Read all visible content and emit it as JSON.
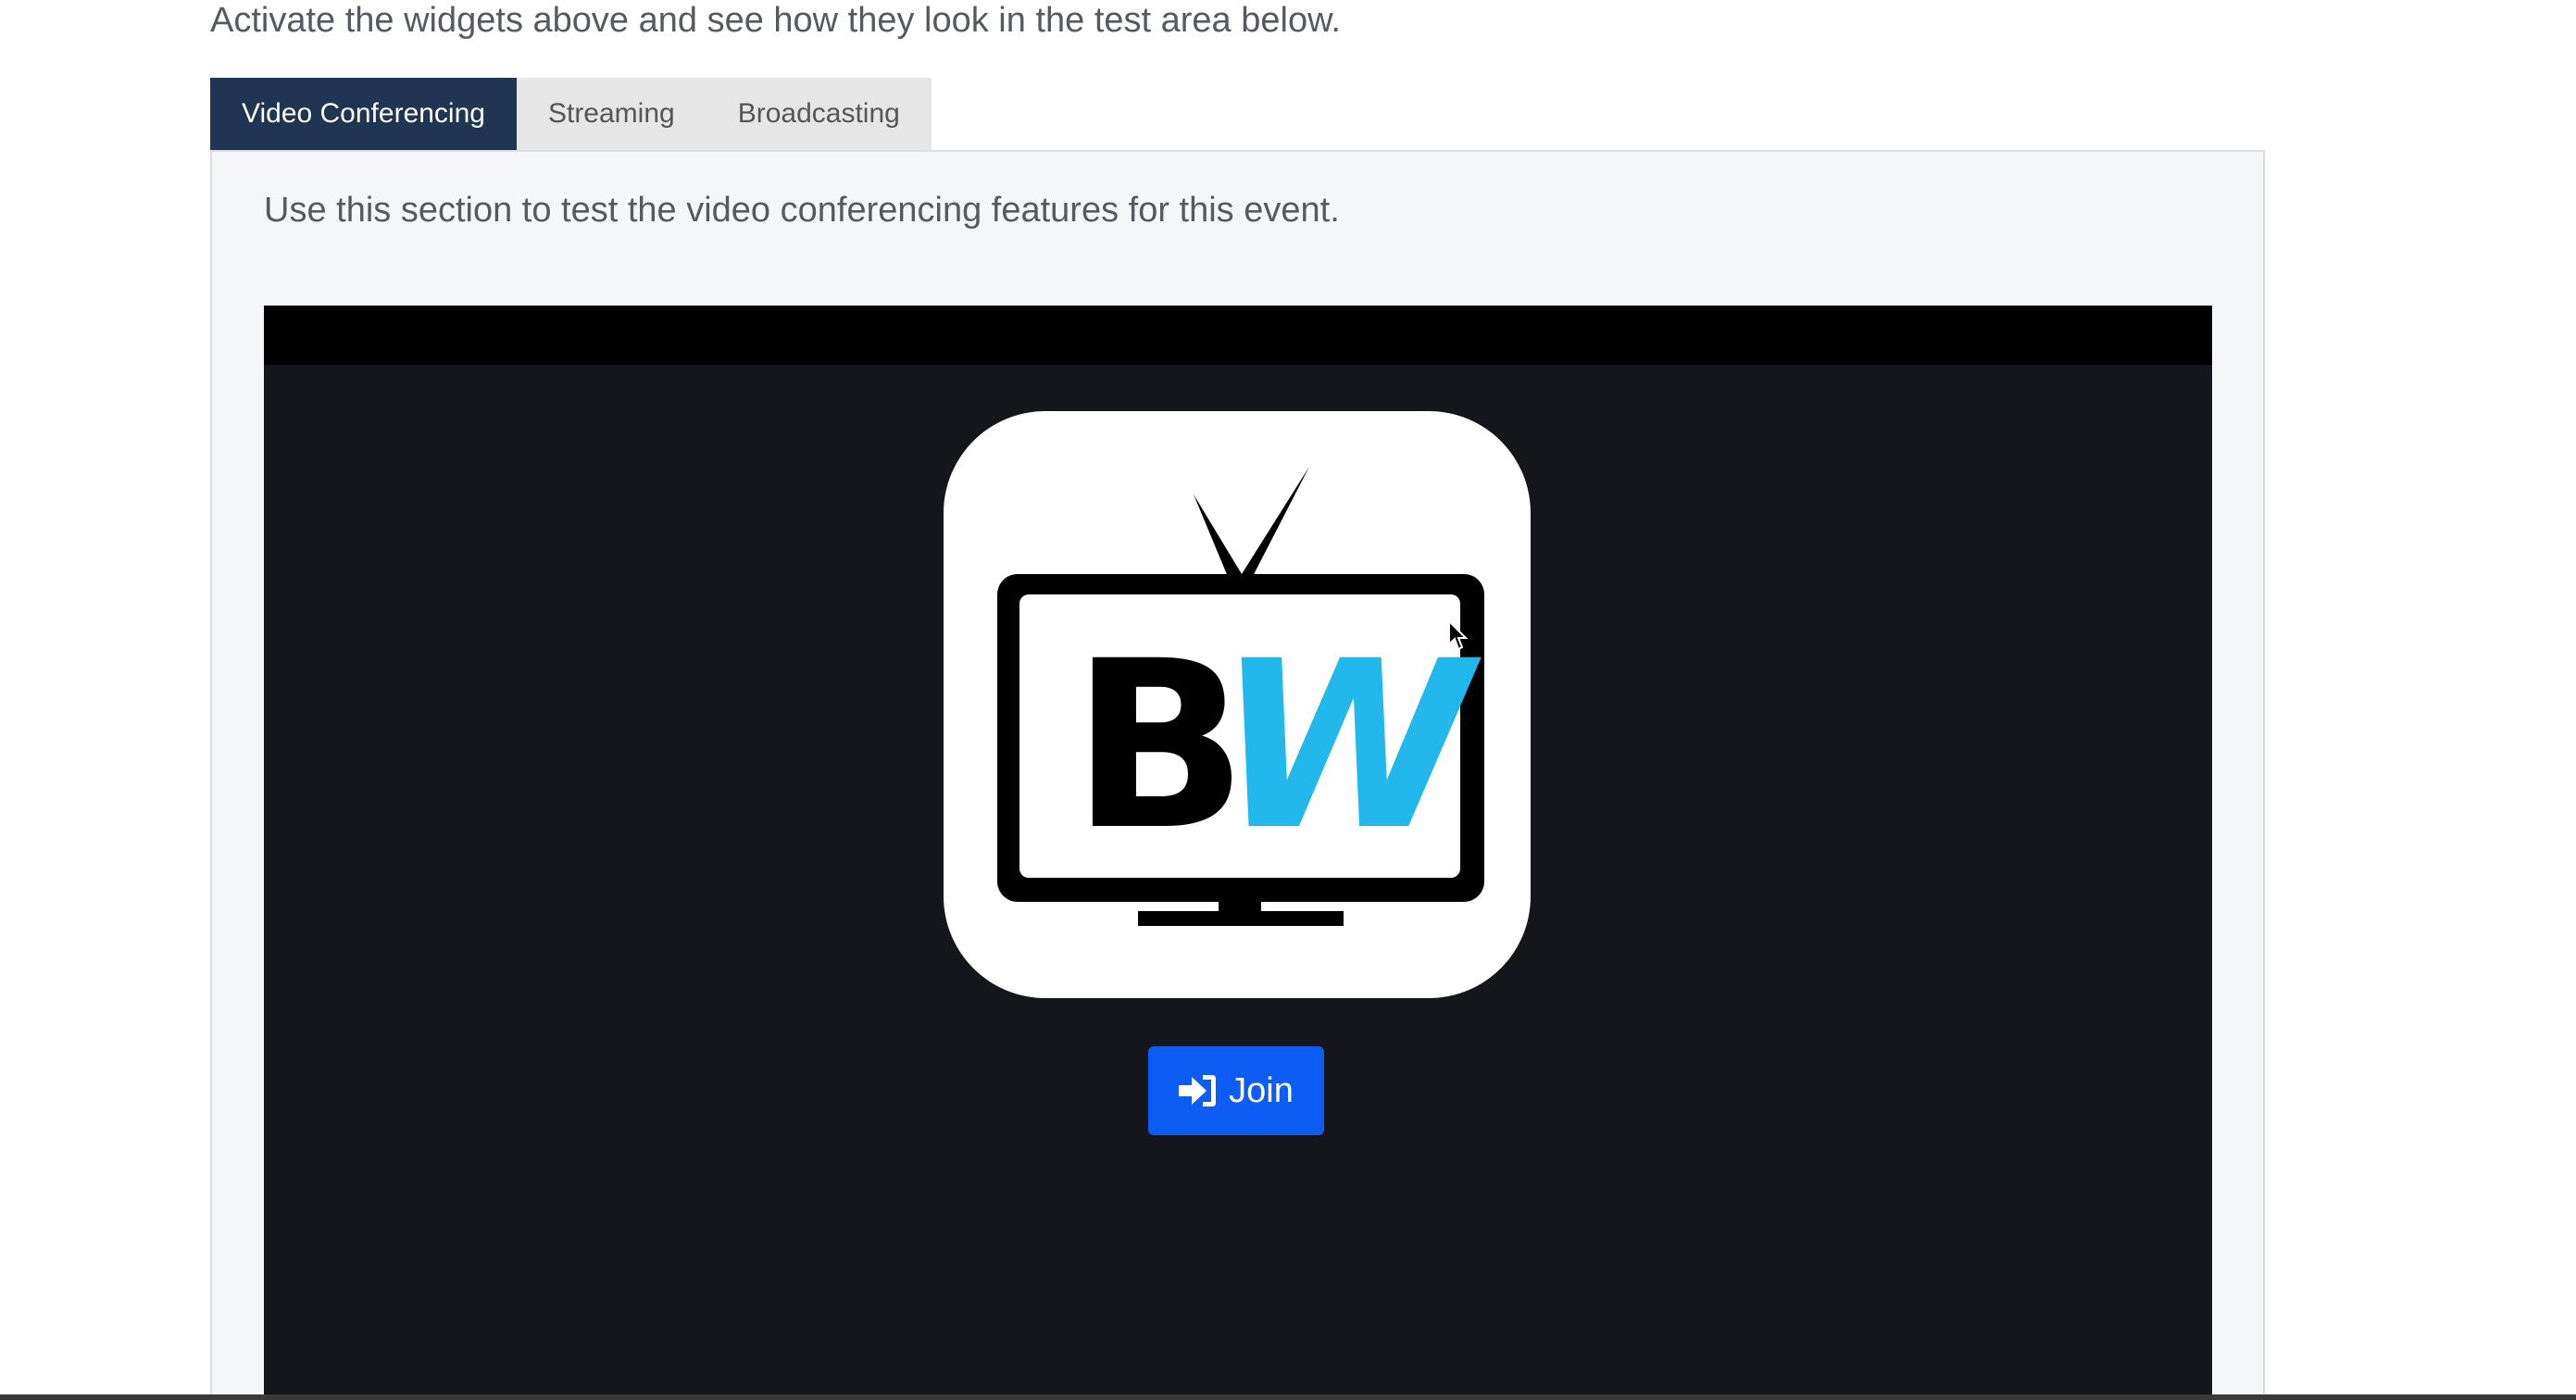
{
  "intro_text": "Activate the widgets above and see how they look in the test area below.",
  "tabs": [
    {
      "label": "Video Conferencing",
      "active": true
    },
    {
      "label": "Streaming",
      "active": false
    },
    {
      "label": "Broadcasting",
      "active": false
    }
  ],
  "panel": {
    "description": "Use this section to test the video conferencing features for this event."
  },
  "logo": {
    "letters_left": "B",
    "letters_right": "W",
    "icon": "tv-icon",
    "colors": {
      "left": "#000000",
      "right": "#22b8ec"
    }
  },
  "join_button": {
    "label": "Join",
    "icon": "sign-in-icon",
    "color": "#0d5cf3"
  },
  "colors": {
    "active_tab": "#1e3553",
    "player_background": "#14161b"
  }
}
